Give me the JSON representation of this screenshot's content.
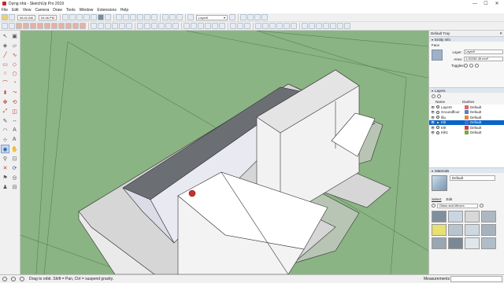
{
  "window": {
    "title": "Dựng nhà - SketchUp Pro 2019",
    "controls": [
      "—",
      "☐",
      "✕"
    ]
  },
  "menu": [
    "File",
    "Edit",
    "View",
    "Camera",
    "Draw",
    "Tools",
    "Window",
    "Extensions",
    "Help"
  ],
  "toolbar": {
    "date_field": "06:42 AM",
    "time_field": "04:46 PM",
    "layer_combo": "Layer0",
    "layer_combo_arrow": "▾"
  },
  "tray": {
    "title": "Default Tray",
    "close": "✕",
    "entity_info": {
      "header": "Entity Info",
      "type": "Face",
      "layer_label": "Layer:",
      "layer_value": "Layer0",
      "area_label": "Area:",
      "area_value": "1.00236 46 mm²",
      "toggles_label": "Toggles:"
    },
    "layers": {
      "header": "Layers",
      "col_name": "Name",
      "col_dashes": "Dashes",
      "rows": [
        {
          "name": "Layer0",
          "dashes": "Default",
          "color": "#e06666",
          "selected": false
        },
        {
          "name": "Groundfloor",
          "dashes": "Default",
          "color": "#5b7fb8",
          "selected": false
        },
        {
          "name": "lầu",
          "dashes": "Default",
          "color": "#e08a3c",
          "selected": false
        },
        {
          "name": "trệt",
          "dashes": "Default",
          "color": "#3c6fd0",
          "selected": true
        },
        {
          "name": "trệt",
          "dashes": "Default",
          "color": "#d04040",
          "selected": false
        },
        {
          "name": "trệt1",
          "dashes": "Default",
          "color": "#7aa83a",
          "selected": false
        }
      ]
    },
    "materials": {
      "header": "Materials",
      "name_value": "Default",
      "tab_select": "Select",
      "tab_edit": "Edit",
      "library": "Glass and Mirrors",
      "swatches": [
        "#7f8fa0",
        "#c9d6e2",
        "#d8d8d8",
        "#aeb8c2",
        "#e8e070",
        "#b8c4d0",
        "#cfd8e0",
        "#a6b2be",
        "#9aa6b2",
        "#7b8794",
        "#dfe6ec",
        "#b0bcc8"
      ]
    }
  },
  "status": {
    "hint": "Drag to orbit. Shift = Pan, Ctrl = suspend gravity.",
    "measurements_label": "Measurements"
  }
}
